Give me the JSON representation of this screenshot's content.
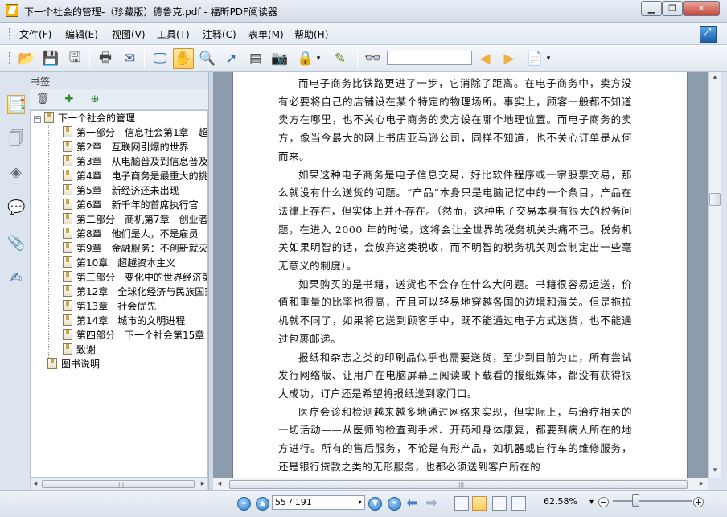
{
  "window": {
    "title": "下一个社会的管理-（珍藏版）德鲁克.pdf - 福昕PDF阅读器",
    "minimize": "▁",
    "restore": "❐",
    "close": "✕"
  },
  "menubar": {
    "items": [
      "文件(F)",
      "编辑(E)",
      "视图(V)",
      "工具(T)",
      "注释(C)",
      "表单(M)",
      "帮助(H)"
    ]
  },
  "toolbar": {
    "icons": [
      "open-folder-icon",
      "save-icon",
      "save-all-icon",
      "print-icon",
      "email-icon",
      "fullscreen-icon",
      "hand-tool-icon",
      "zoom-tool-icon",
      "select-arrow-icon",
      "text-select-icon",
      "snapshot-icon",
      "rms-lock-icon",
      "sign-icon",
      "find-binoculars-icon",
      "find-prev-icon",
      "find-next-icon",
      "find-options-icon"
    ],
    "search_value": ""
  },
  "sidebar": {
    "panel_title": "书签",
    "icons": [
      "bookmarks-panel-icon",
      "pages-panel-icon",
      "layers-panel-icon",
      "comments-panel-icon",
      "attachments-panel-icon",
      "signatures-panel-icon"
    ],
    "tools": [
      "delete-bookmark-icon",
      "new-bookmark-icon",
      "new-child-bookmark-icon"
    ],
    "bookmarks": [
      {
        "label": "下一个社会的管理",
        "level": 0,
        "expanded": true
      },
      {
        "label": "第一部分　信息社会第1章　超",
        "level": 1
      },
      {
        "label": "第2章　互联网引爆的世界",
        "level": 1
      },
      {
        "label": "第3章　从电脑普及到信息普及",
        "level": 1
      },
      {
        "label": "第4章　电子商务是最重大的挑",
        "level": 1
      },
      {
        "label": "第5章　新经济还未出现",
        "level": 1
      },
      {
        "label": "第6章　新千年的首席执行官",
        "level": 1
      },
      {
        "label": "第二部分　商机第7章　创业者",
        "level": 1
      },
      {
        "label": "第8章　他们是人，不是雇员",
        "level": 1
      },
      {
        "label": "第9章　金融服务：不创新就灭",
        "level": 1
      },
      {
        "label": "第10章　超越资本主义",
        "level": 1
      },
      {
        "label": "第三部分　变化中的世界经济第",
        "level": 1
      },
      {
        "label": "第12章　全球化经济与民族国家",
        "level": 1
      },
      {
        "label": "第13章　社会优先",
        "level": 1
      },
      {
        "label": "第14章　城市的文明进程",
        "level": 1
      },
      {
        "label": "第四部分　下一个社会第15章",
        "level": 1
      },
      {
        "label": "致谢",
        "level": 1
      },
      {
        "label": "图书说明",
        "level": 0
      }
    ]
  },
  "document": {
    "paragraphs": [
      "而电子商务比铁路更进了一步，它消除了距离。在电子商务中，卖方没有必要将自己的店铺设在某个特定的物理场所。事实上，顾客一般都不知道卖方在哪里，也不关心电子商务的卖方设在哪个地理位置。而电子商务的卖方，像当今最大的网上书店亚马逊公司，同样不知道，也不关心订单是从何而来。",
      "如果这种电子商务是电子信息交易，好比软件程序或一宗股票交易，那么就没有什么送货的问题。“产品”本身只是电脑记忆中的一个条目，产品在法律上存在，但实体上并不存在。（然而，这种电子交易本身有很大的税务问题，在进入 2000 年的时候，这将会让全世界的税务机关头痛不已。税务机关如果明智的话，会放弃这类税收，而不明智的税务机关则会制定出一些毫无意义的制度）。",
      "如果购买的是书籍，送货也不会存在什么大问题。书籍很容易运送，价值和重量的比率也很高，而且可以轻易地穿越各国的边境和海关。但是拖拉机就不同了，如果将它送到顾客手中，既不能通过电子方式送货，也不能通过包裹邮递。",
      "报纸和杂志之类的印刷品似乎也需要送货，至少到目前为止，所有尝试发行网络版、让用户在电脑屏幕上阅读或下载看的报纸媒体，都没有获得很大成功，订户还是希望将报纸送到家门口。",
      "医疗会诊和检测越来越多地通过网络来实现，但实际上，与治疗相关的一切活动——从医师的检查到手术、开药和身体康复，都要到病人所在的地方进行。所有的售后服务，不论是有形产品，如机器或自行车的维修服务，还是银行贷款之类的无形服务，也都必须送到客户所在的"
    ]
  },
  "statusbar": {
    "page_indicator": "55 / 191",
    "zoom_level": "62.58%",
    "zoom_dropdown": "▾",
    "zoom_minus": "−",
    "zoom_plus": "+"
  }
}
